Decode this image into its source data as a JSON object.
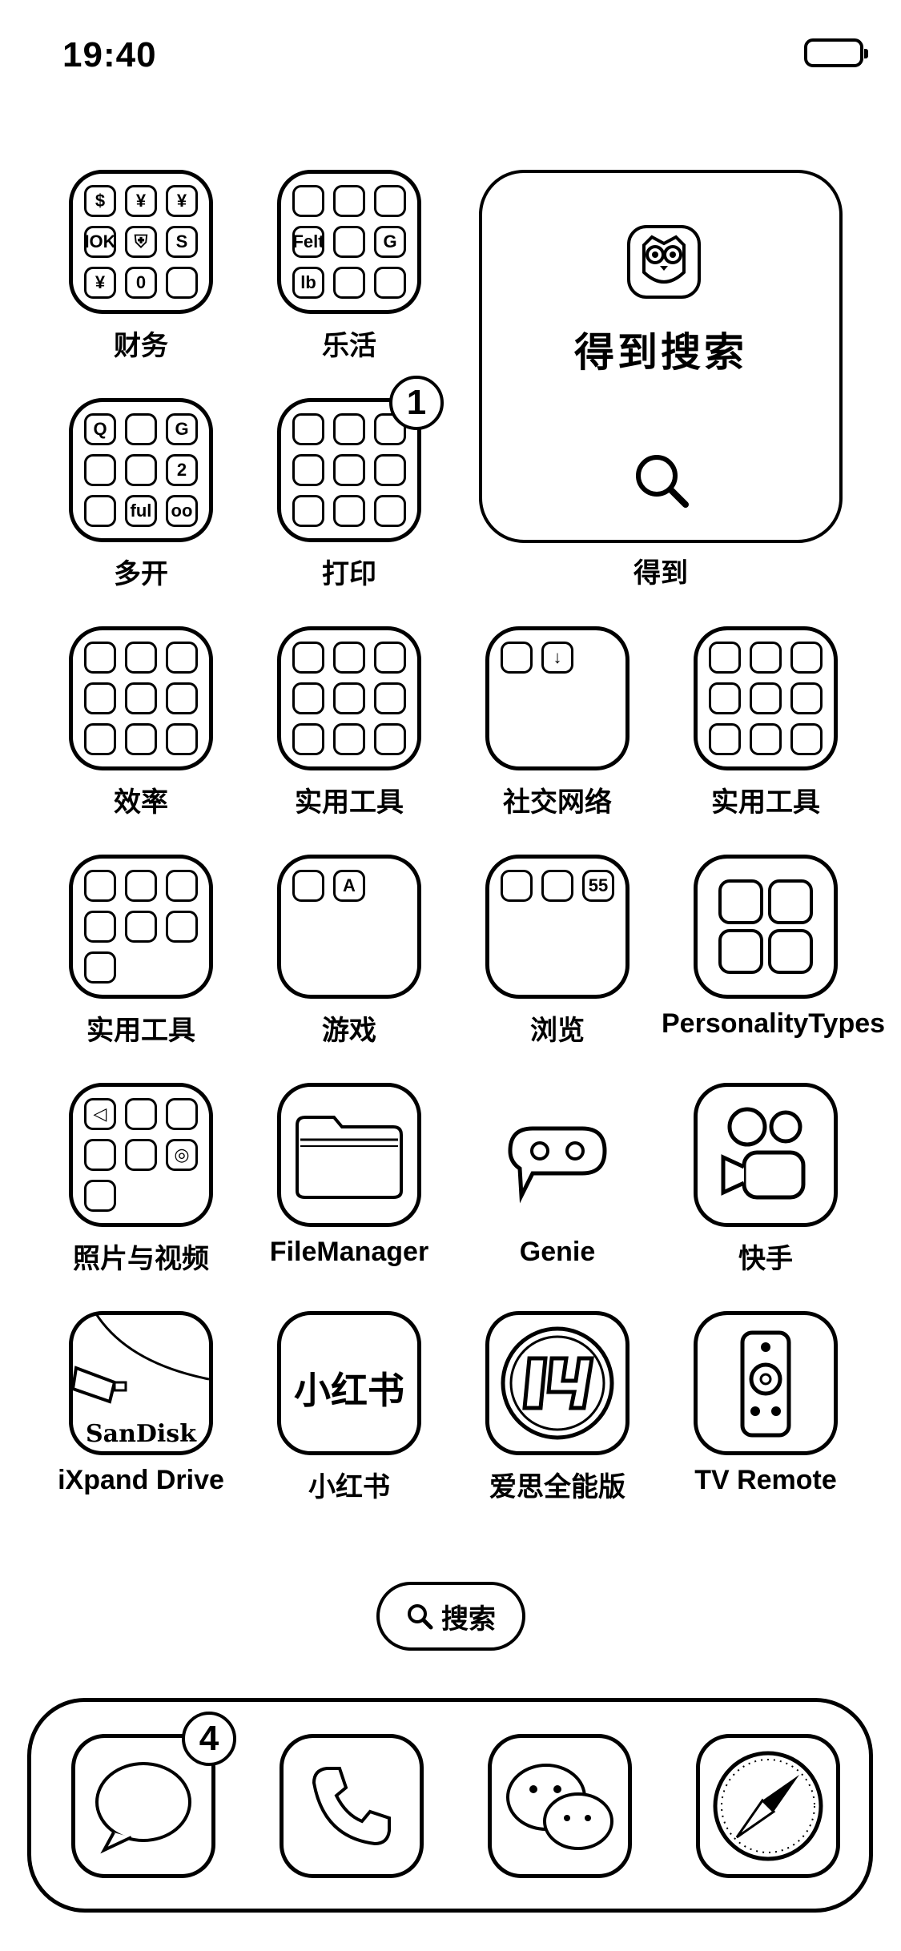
{
  "status_bar": {
    "time": "19:40"
  },
  "apps": [
    {
      "label": "财务"
    },
    {
      "label": "乐活"
    },
    {
      "label": "多开"
    },
    {
      "label": "打印",
      "badge": "1"
    },
    {
      "label": "效率"
    },
    {
      "label": "实用工具"
    },
    {
      "label": "社交网络"
    },
    {
      "label": "实用工具"
    },
    {
      "label": "实用工具"
    },
    {
      "label": "游戏"
    },
    {
      "label": "浏览"
    },
    {
      "label": "PersonalityTypes"
    },
    {
      "label": "照片与视频"
    },
    {
      "label": "FileManager"
    },
    {
      "label": "Genie"
    },
    {
      "label": "快手"
    },
    {
      "label": "iXpand Drive",
      "logo_text": "SanDisk"
    },
    {
      "label": "小红书",
      "logo_text": "小红书"
    },
    {
      "label": "爱思全能版"
    },
    {
      "label": "TV Remote"
    }
  ],
  "widget": {
    "title": "得到搜索",
    "label": "得到"
  },
  "search_pill": {
    "label": "搜索"
  },
  "dock": {
    "messages_badge": "4"
  },
  "folder_glyphs": {
    "finance": [
      "$",
      "¥",
      "¥",
      "IOK",
      "⛨",
      "S",
      "¥",
      "0",
      ""
    ],
    "leisure": [
      "",
      "",
      "",
      "Felt",
      "",
      "G",
      "lb",
      "",
      ""
    ],
    "multi": [
      "Q",
      "",
      "G",
      "",
      "",
      "2",
      "",
      "ful",
      "oo"
    ],
    "print": [
      "",
      "",
      "",
      "",
      "",
      "",
      "",
      "",
      ""
    ],
    "efficiency": [
      "",
      "",
      "",
      "",
      "",
      "",
      "",
      "",
      ""
    ],
    "utilities1": [
      "",
      "",
      "",
      "",
      "",
      "",
      "",
      "",
      ""
    ],
    "social": [
      "",
      "↓"
    ],
    "utilities2": [
      "",
      "",
      "",
      "",
      "",
      "",
      "",
      "",
      ""
    ],
    "utilities3": [
      "",
      "",
      "",
      "",
      "",
      "",
      ""
    ],
    "games": [
      "",
      "A"
    ],
    "browse": [
      "",
      "",
      "55"
    ],
    "photos": [
      "◁",
      "",
      "",
      "",
      "",
      "◎",
      ""
    ]
  }
}
